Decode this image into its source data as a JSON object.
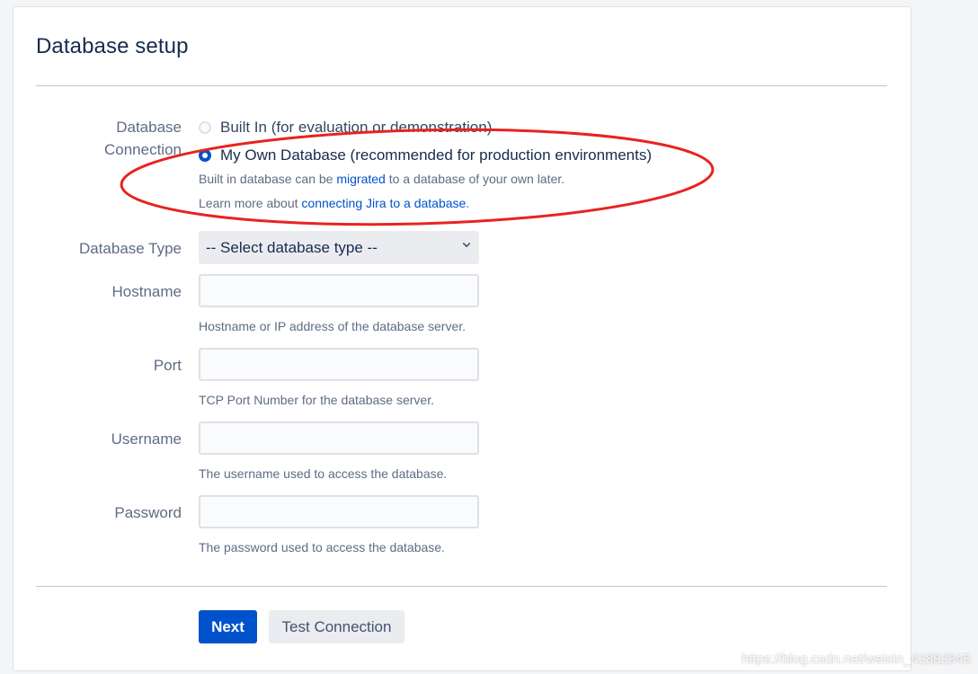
{
  "page": {
    "title": "Database setup"
  },
  "connection": {
    "label_line1": "Database",
    "label_line2": "Connection",
    "option_builtin": "Built In (for evaluation or demonstration)",
    "option_own": "My Own Database (recommended for production environments)",
    "selected": "own",
    "help1_prefix": "Built in database can be ",
    "help1_link": "migrated",
    "help1_suffix": " to a database of your own later.",
    "help2_prefix": "Learn more about ",
    "help2_link": "connecting Jira to a database",
    "help2_suffix": "."
  },
  "fields": {
    "db_type_label": "Database Type",
    "db_type_value": "-- Select database type --",
    "hostname_label": "Hostname",
    "hostname_value": "",
    "hostname_help": "Hostname or IP address of the database server.",
    "port_label": "Port",
    "port_value": "",
    "port_help": "TCP Port Number for the database server.",
    "username_label": "Username",
    "username_value": "",
    "username_help": "The username used to access the database.",
    "password_label": "Password",
    "password_value": "",
    "password_help": "The password used to access the database."
  },
  "actions": {
    "next": "Next",
    "test_connection": "Test Connection"
  },
  "watermark": "https://blog.csdn.net/weixin_42882845",
  "colors": {
    "primary": "#0052cc",
    "annotation": "#e8231f",
    "link": "#0052cc"
  }
}
